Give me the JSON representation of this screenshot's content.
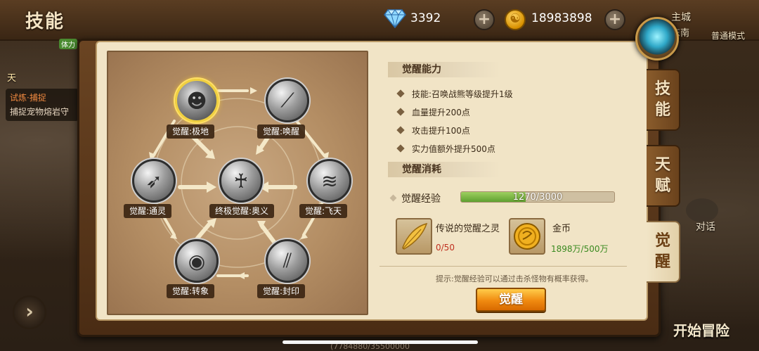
{
  "header": {
    "title": "技能",
    "gems": "3392",
    "gold": "18983898",
    "plus_label": "+"
  },
  "hud": {
    "location_line1": "主城",
    "location_line2": "东南",
    "mode": "普通模式"
  },
  "left_overlay": {
    "tag": "体力",
    "day": "天",
    "quest_title": "试炼·捕捉",
    "quest_desc": "捕捉宠物熔岩守"
  },
  "skill_tree": {
    "nodes": [
      {
        "label": "觉醒:极地",
        "glyph": "☻"
      },
      {
        "label": "觉醒:唤醒",
        "glyph": "⟋"
      },
      {
        "label": "觉醒:通灵",
        "glyph": "➶"
      },
      {
        "label": "终极觉醒:奥义",
        "glyph": "♰"
      },
      {
        "label": "觉醒:飞天",
        "glyph": "≋"
      },
      {
        "label": "觉醒:转象",
        "glyph": "◉"
      },
      {
        "label": "觉醒:封印",
        "glyph": "⫽"
      }
    ]
  },
  "ability": {
    "header": "觉醒能力",
    "bullets": [
      "技能:召唤战熊等级提升1级",
      "血量提升200点",
      "攻击提升100点",
      "实力值额外提升500点"
    ]
  },
  "cost": {
    "header": "觉醒消耗",
    "exp_label": "觉醒经验",
    "exp_text": "1270/3000",
    "exp_progress": 0.4233,
    "item1_name": "传说的觉醒之灵",
    "item1_qty": "0/50",
    "item2_name": "金币",
    "item2_qty": "1898万/500万"
  },
  "hint": "提示:觉醒经验可以通过击杀怪物有概率获得。",
  "awaken_button": "觉醒",
  "tabs": [
    "技能",
    "天赋",
    "觉醒"
  ],
  "right_overlay": {
    "dialog": "对话",
    "start": "开始冒险"
  },
  "bottom_text": "(7784880/35500000",
  "colors": {
    "exp_fill": "#7cbf45",
    "button": "#f08a10",
    "active_node_ring": "#ffe066",
    "panel_bg": "#f1e4c6"
  }
}
